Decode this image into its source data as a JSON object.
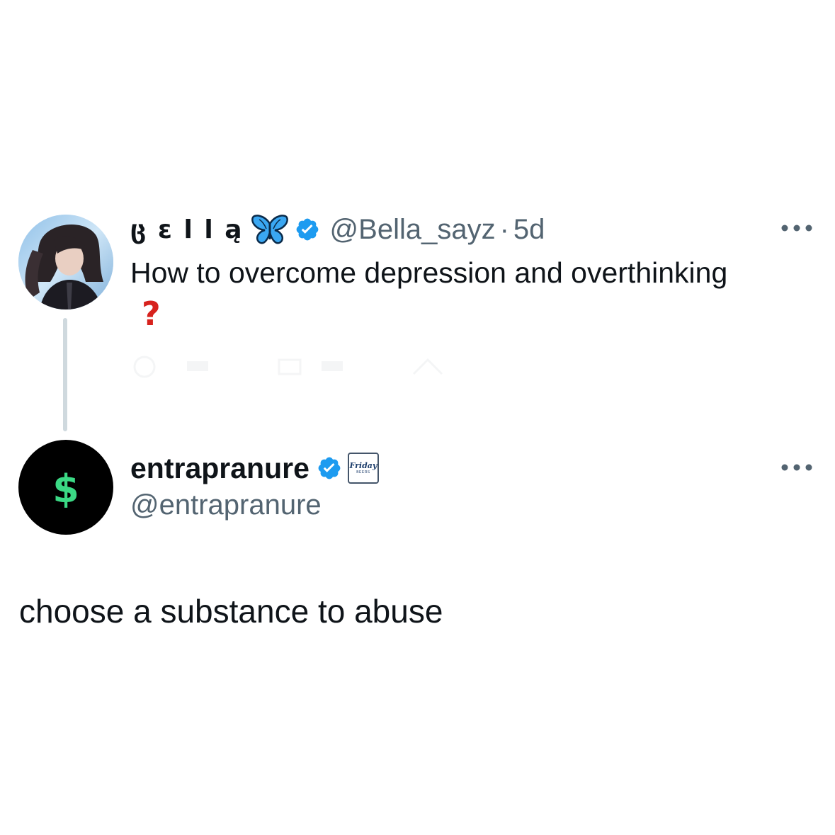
{
  "parent_tweet": {
    "display_name": "ც ε l l ą",
    "name_emoji": "butterfly-icon",
    "verified": true,
    "handle": "@Bella_sayz",
    "separator": "·",
    "time": "5d",
    "text": "How to overcome depression and overthinking",
    "trailing_emoji": "?"
  },
  "reply_tweet": {
    "avatar_symbol": "$",
    "display_name": "entrapranure",
    "verified": true,
    "affiliate_badge": {
      "line1": "Friday",
      "line2": "BEERS"
    },
    "handle": "@entrapranure",
    "text": "choose a substance to abuse"
  },
  "colors": {
    "text_primary": "#0f1419",
    "text_secondary": "#536471",
    "verified_blue": "#1d9bf0",
    "thread_line": "#cfd9de",
    "dollar_green": "#3bd985",
    "question_red": "#d7221d"
  }
}
